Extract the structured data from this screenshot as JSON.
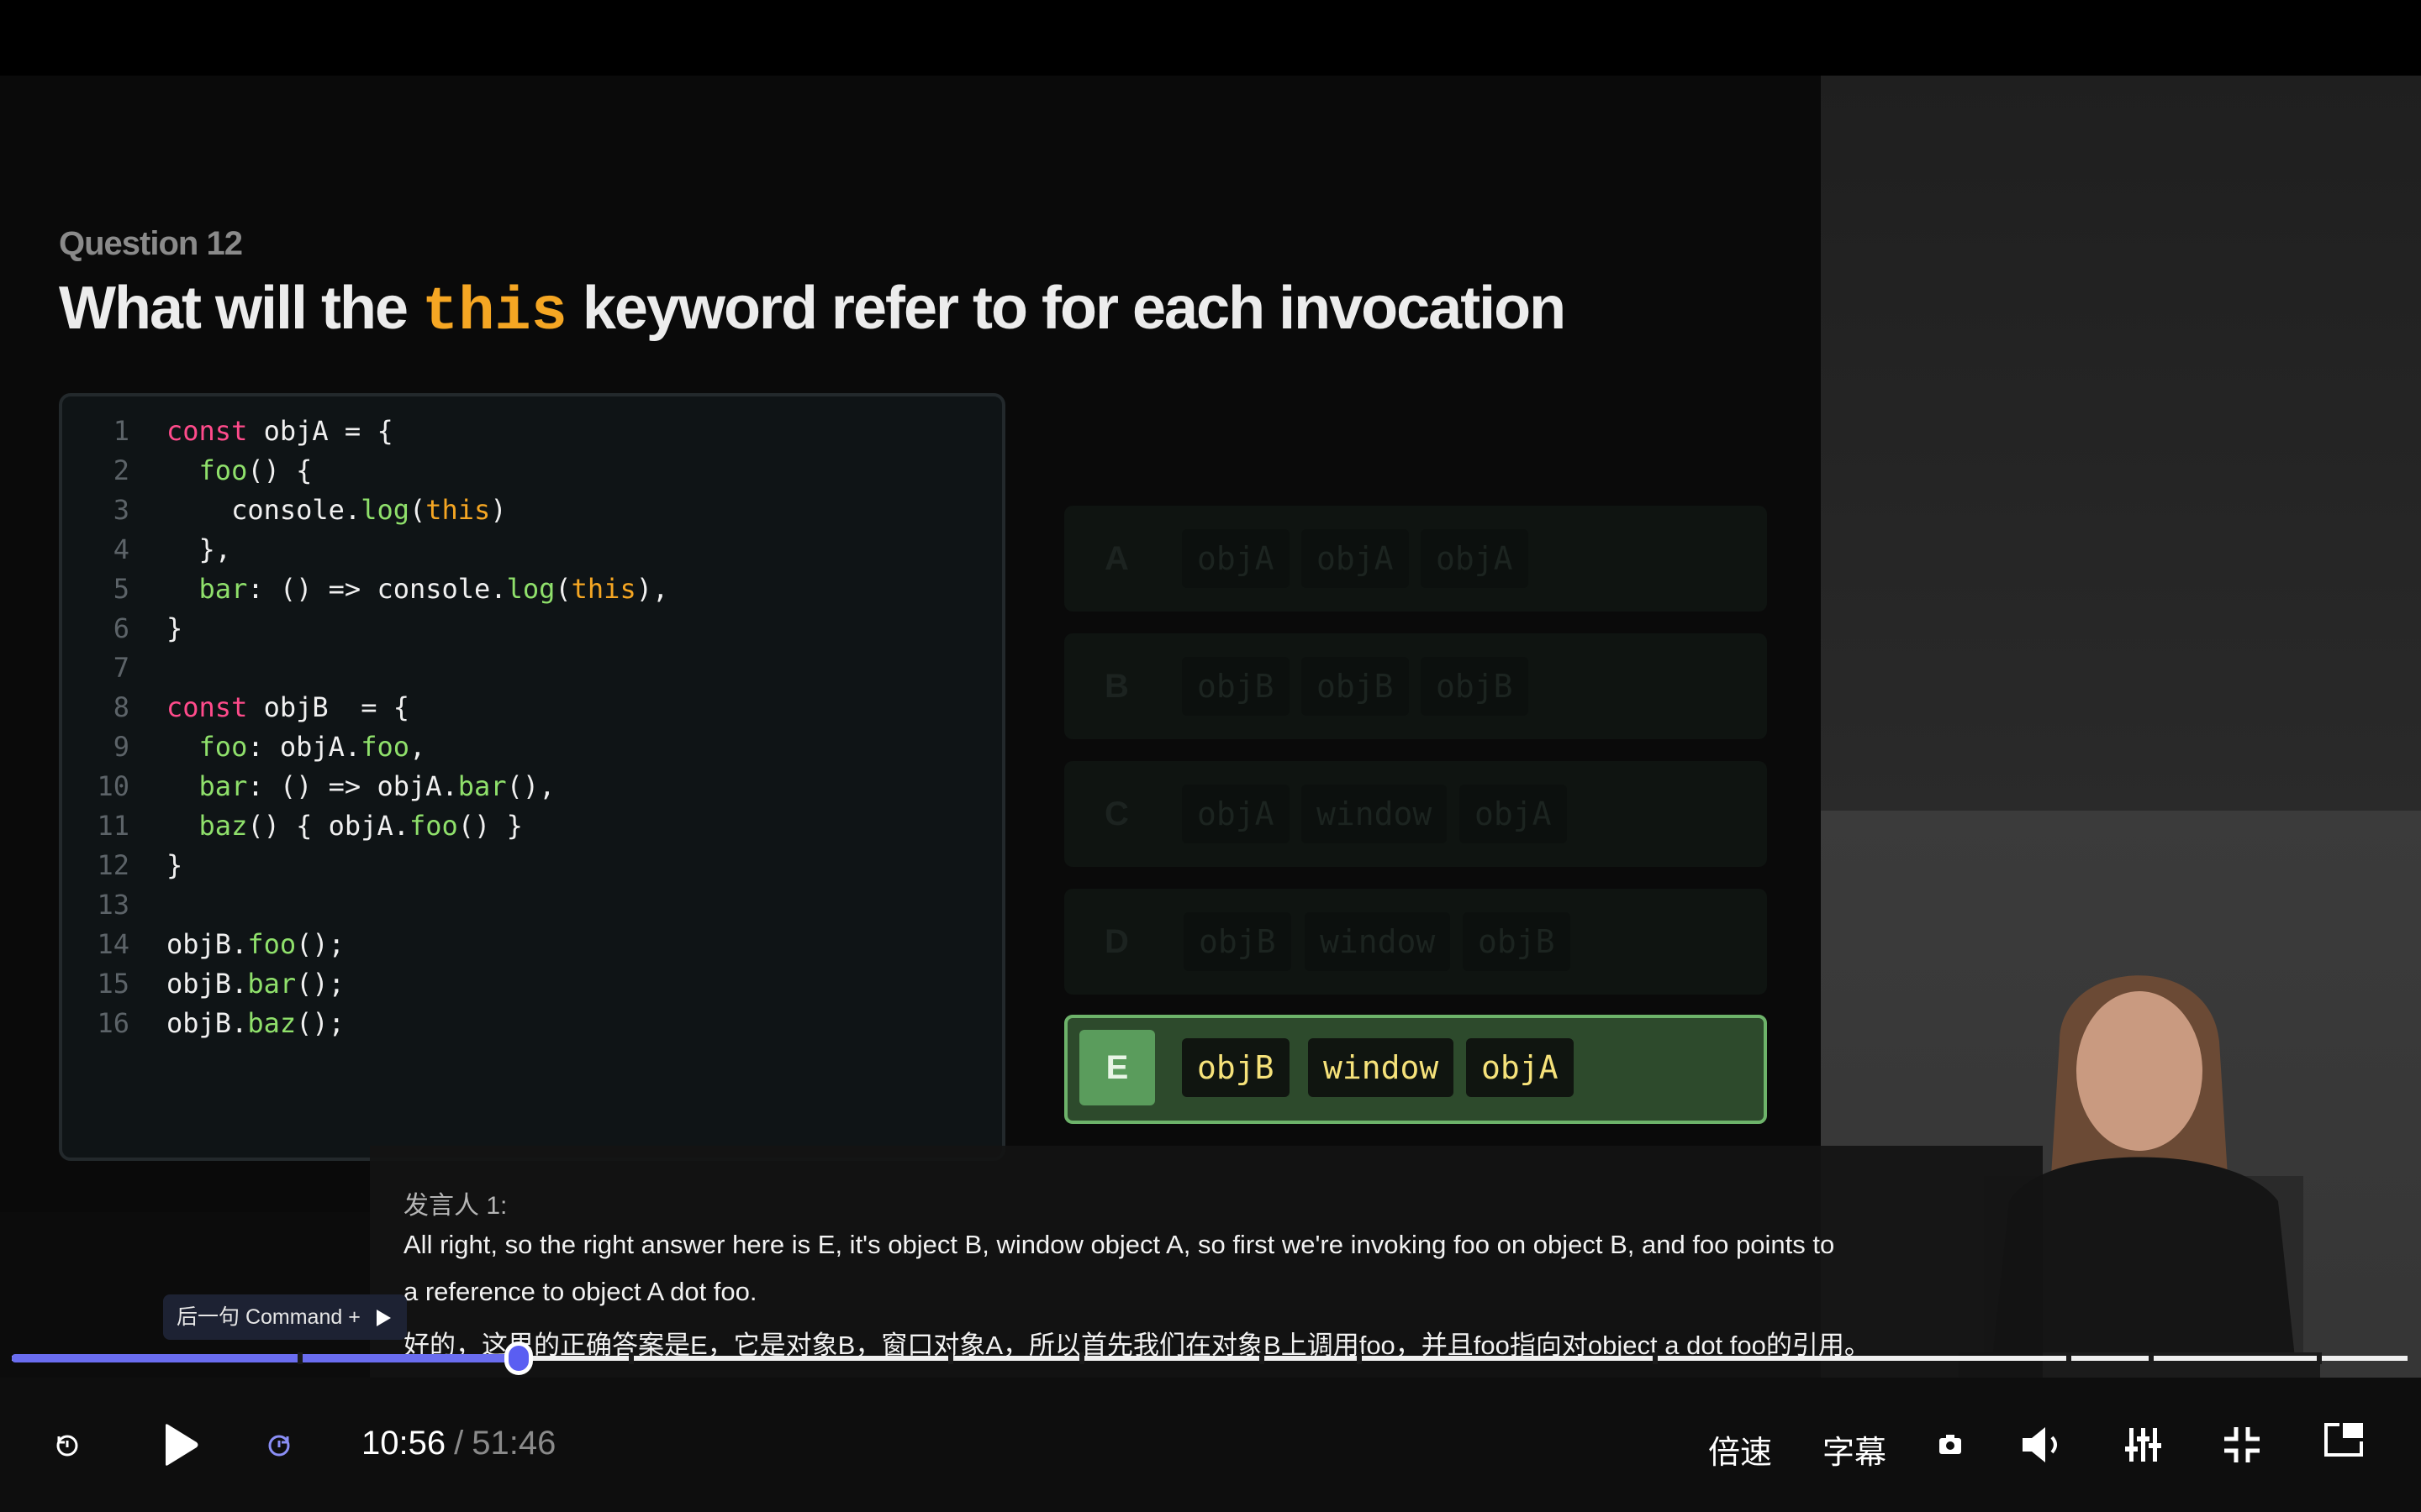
{
  "slide": {
    "question_label": "Question 12",
    "title_before": "What will the ",
    "title_keyword": "this",
    "title_after": " keyword refer to for each invocation",
    "code_lines": [
      {
        "n": "1"
      },
      {
        "n": "2"
      },
      {
        "n": "3"
      },
      {
        "n": "4"
      },
      {
        "n": "5"
      },
      {
        "n": "6"
      },
      {
        "n": "7"
      },
      {
        "n": "8"
      },
      {
        "n": "9"
      },
      {
        "n": "10"
      },
      {
        "n": "11"
      },
      {
        "n": "12"
      },
      {
        "n": "13"
      },
      {
        "n": "14"
      },
      {
        "n": "15"
      },
      {
        "n": "16"
      }
    ],
    "code_tokens": {
      "l1": [
        "const",
        " objA = {"
      ],
      "l2": [
        "foo",
        "() {"
      ],
      "l3": [
        "console.",
        "log",
        "(",
        "this",
        ")"
      ],
      "l4": [
        "},"
      ],
      "l5": [
        "bar",
        ": () => console.",
        "log",
        "(",
        "this",
        "),"
      ],
      "l6": [
        "}"
      ],
      "l8": [
        "const",
        " objB  = {"
      ],
      "l9": [
        "foo",
        ": objA.",
        "foo",
        ","
      ],
      "l10": [
        "bar",
        ": () => objA.",
        "bar",
        "(),"
      ],
      "l11": [
        "baz",
        "() { objA.",
        "foo",
        "() }"
      ],
      "l12": [
        "}"
      ],
      "l14": [
        "objB.",
        "foo",
        "();"
      ],
      "l15": [
        "objB.",
        "bar",
        "();"
      ],
      "l16": [
        "objB.",
        "baz",
        "();"
      ]
    },
    "options": [
      {
        "letter": "A",
        "answers": [
          "objA",
          "objA",
          "objA"
        ]
      },
      {
        "letter": "B",
        "answers": [
          "objB",
          "objB",
          "objB"
        ]
      },
      {
        "letter": "C",
        "answers": [
          "objA",
          "window",
          "objA"
        ]
      },
      {
        "letter": "D",
        "answers": [
          "objB",
          "window",
          "objB"
        ]
      },
      {
        "letter": "E",
        "answers": [
          "objB",
          "window",
          "objA"
        ]
      }
    ],
    "correct_option": "E"
  },
  "subtitle": {
    "speaker": "发言人 1:",
    "line1": "All right, so the right answer here is E, it's object B, window object A, so first we're invoking foo on object B, and foo points to",
    "line2": "a reference to object A dot foo.",
    "line3": "好的，这里的正确答案是E，它是对象B，窗口对象A，所以首先我们在对象B上调用foo，并且foo指向对object a dot foo的引用。"
  },
  "player": {
    "tooltip": "后一句 Command +",
    "current_time": "10:56",
    "separator": "/",
    "duration": "51:46",
    "progress_fraction": 0.2115,
    "speed_label": "倍速",
    "subtitle_label": "字幕",
    "colors": {
      "progress": "#6a6df0",
      "correct": "#5a9c5c",
      "keyword": "#f5a623"
    }
  },
  "icons": [
    "rewind-icon",
    "play-icon",
    "forward-icon",
    "screenshot-icon",
    "volume-icon",
    "equalizer-icon",
    "exit-fullscreen-icon",
    "picture-in-picture-icon",
    "triangle-right-icon"
  ]
}
